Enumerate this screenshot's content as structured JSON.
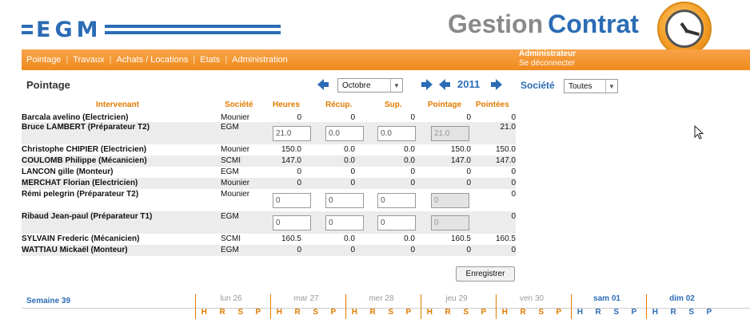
{
  "header": {
    "logo_text": "EGM",
    "brand_gestion": "Gestion",
    "brand_contrat": "Contrat",
    "user_role": "Administrateur",
    "logout": "Se déconnecter"
  },
  "nav": [
    "Pointage",
    "Travaux",
    "Achats / Locations",
    "Etats",
    "Administration"
  ],
  "toolbar": {
    "title": "Pointage",
    "month": "Octobre",
    "year": "2011",
    "societe_label": "Société",
    "societe_value": "Toutes"
  },
  "table": {
    "headers": [
      "Intervenant",
      "Société",
      "Heures",
      "Récup.",
      "Sup.",
      "Pointage",
      "Pointées"
    ],
    "rows": [
      {
        "name": "Barcala avelino (Electricien)",
        "soc": "Mounier",
        "heures": "0",
        "recup": "0",
        "sup": "0",
        "pointage": "0",
        "pointees": "0"
      },
      {
        "name": "Bruce LAMBERT (Préparateur T2)",
        "soc": "EGM",
        "heures": "21.0",
        "recup": "0.0",
        "sup": "0.0",
        "pointage": "21.0",
        "pointees": "21.0"
      },
      {
        "name": "Christophe CHIPIER (Electricien)",
        "soc": "Mounier",
        "heures": "150.0",
        "recup": "0.0",
        "sup": "0.0",
        "pointage": "150.0",
        "pointees": "150.0"
      },
      {
        "name": "COULOMB Philippe (Mécanicien)",
        "soc": "SCMI",
        "heures": "147.0",
        "recup": "0.0",
        "sup": "0.0",
        "pointage": "147.0",
        "pointees": "147.0"
      },
      {
        "name": "LANCON gille (Monteur)",
        "soc": "EGM",
        "heures": "0",
        "recup": "0",
        "sup": "0",
        "pointage": "0",
        "pointees": "0"
      },
      {
        "name": "MERCHAT Florian (Electricien)",
        "soc": "Mounier",
        "heures": "0",
        "recup": "0",
        "sup": "0",
        "pointage": "0",
        "pointees": "0"
      },
      {
        "name": "Rémi pelegrin (Préparateur T2)",
        "soc": "Mounier",
        "heures": "0",
        "recup": "0",
        "sup": "0",
        "pointage": "0",
        "pointees": "0"
      },
      {
        "name": "Ribaud Jean-paul (Préparateur T1)",
        "soc": "EGM",
        "heures": "0",
        "recup": "0",
        "sup": "0",
        "pointage": "0",
        "pointees": "0"
      },
      {
        "name": "SYLVAIN Frederic (Mécanicien)",
        "soc": "SCMI",
        "heures": "160.5",
        "recup": "0.0",
        "sup": "0.0",
        "pointage": "160.5",
        "pointees": "160.5"
      },
      {
        "name": "WATTIAU Mickaël (Monteur)",
        "soc": "EGM",
        "heures": "0",
        "recup": "0",
        "sup": "0",
        "pointage": "0",
        "pointees": "0"
      }
    ],
    "save_label": "Enregistrer"
  },
  "week": {
    "label": "Semaine 39",
    "days": [
      "lun 26",
      "mar 27",
      "mer 28",
      "jeu 29",
      "ven 30",
      "sam 01",
      "dim 02"
    ],
    "cols": [
      "H",
      "R",
      "S",
      "P"
    ]
  }
}
